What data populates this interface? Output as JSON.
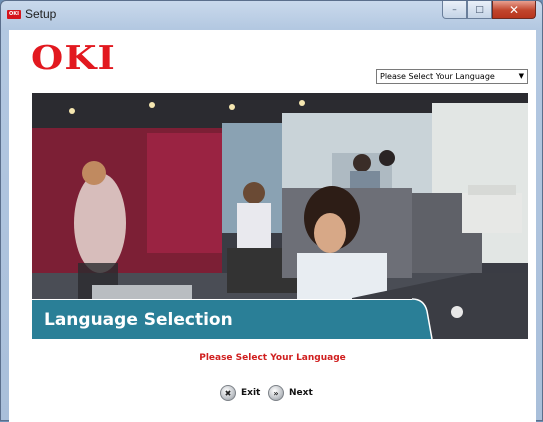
{
  "window": {
    "title": "Setup",
    "app_icon_text": "OKI",
    "buttons": {
      "minimize": "–",
      "maximize": "□",
      "close": "✕"
    }
  },
  "brand": {
    "logo_text": "OKI",
    "color": "#e2181f"
  },
  "language_dropdown": {
    "selected": "Please Select Your Language"
  },
  "banner": {
    "title": "Language Selection",
    "color": "#2a7f97"
  },
  "prompt": {
    "text": "Please Select Your Language",
    "color": "#d01f1f"
  },
  "actions": {
    "exit": {
      "label": "Exit",
      "icon": "✖"
    },
    "next": {
      "label": "Next",
      "icon": "»"
    }
  }
}
